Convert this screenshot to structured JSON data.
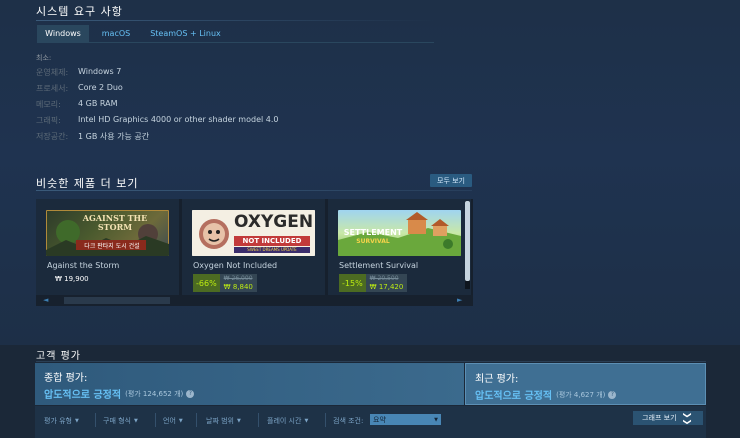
{
  "system_requirements": {
    "title": "시스템 요구 사항",
    "tabs": [
      "Windows",
      "macOS",
      "SteamOS + Linux"
    ],
    "active_tab": "Windows",
    "min_label": "최소:",
    "rows": [
      {
        "key": "운영체제:",
        "value": "Windows 7"
      },
      {
        "key": "프로세서:",
        "value": "Core 2 Duo"
      },
      {
        "key": "메모리:",
        "value": "4 GB RAM"
      },
      {
        "key": "그래픽:",
        "value": "Intel HD Graphics 4000 or other shader model 4.0"
      },
      {
        "key": "저장공간:",
        "value": "1 GB 사용 가능 공간"
      }
    ]
  },
  "similar": {
    "title": "비슷한 제품 더 보기",
    "see_all": "모두 보기",
    "games": [
      {
        "name": "Against the Storm",
        "price": "₩ 19,900",
        "capsule_text": "AGAINST THE STORM",
        "capsule_subtext": "다크 판타지 도시 건설"
      },
      {
        "name": "Oxygen Not Included",
        "discount": "-66%",
        "original": "₩ 26,000",
        "final": "₩ 8,840",
        "capsule_text": "OXYGEN",
        "capsule_subtext": "NOT INCLUDED",
        "capsule_tag": "SWEET DREAMS UPDATE"
      },
      {
        "name": "Settlement Survival",
        "discount": "-15%",
        "original": "₩ 20,500",
        "final": "₩ 17,420",
        "capsule_text": "SETTLEMENT",
        "capsule_subtext": "SURVIVAL"
      }
    ],
    "scroll": {
      "left_arrow": "◄",
      "right_arrow": "►"
    }
  },
  "reviews": {
    "title": "고객 평가",
    "overall": {
      "label": "종합 평가:",
      "summary": "압도적으로 긍정적",
      "count": "(평가 124,652 개)"
    },
    "recent": {
      "label": "최근 평가:",
      "summary": "압도적으로 긍정적",
      "count": "(평가 4,627 개)"
    },
    "help_icon": "?",
    "filters": [
      "평가 유형",
      "구매 형식",
      "언어",
      "날짜 범위",
      "플레이 시간"
    ],
    "filter_caret": "▼",
    "search_label": "검색 조건:",
    "language_value": "요약",
    "graph_button": "그래프 보기",
    "graph_chevron": "❯❯"
  },
  "colors": {
    "accent": "#66c0f4",
    "discount_bg": "#4c6b22",
    "discount_text": "#beee11"
  }
}
